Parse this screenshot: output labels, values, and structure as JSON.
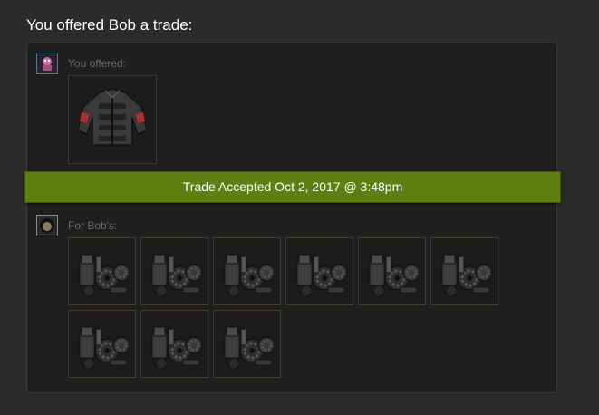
{
  "header": {
    "title": "You offered Bob a trade:"
  },
  "offer": {
    "label": "You offered:",
    "items": [
      {
        "icon": "jacket-item-icon"
      }
    ]
  },
  "status": {
    "text": "Trade Accepted Oct 2, 2017 @ 3:48pm",
    "color": "#5d8011"
  },
  "request": {
    "label": "For Bob's:",
    "items": [
      {
        "icon": "metal-parts-item-icon"
      },
      {
        "icon": "metal-parts-item-icon"
      },
      {
        "icon": "metal-parts-item-icon"
      },
      {
        "icon": "metal-parts-item-icon"
      },
      {
        "icon": "metal-parts-item-icon"
      },
      {
        "icon": "metal-parts-item-icon"
      },
      {
        "icon": "metal-parts-item-icon"
      },
      {
        "icon": "metal-parts-item-icon"
      },
      {
        "icon": "metal-parts-item-icon"
      }
    ]
  }
}
